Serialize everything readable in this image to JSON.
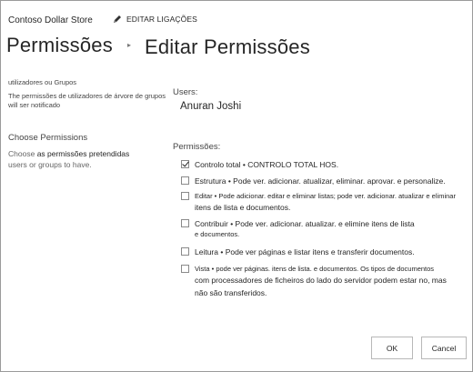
{
  "header": {
    "site_name": "Contoso Dollar Store",
    "edit_links": "EDITAR LIGAÇÕES",
    "breadcrumb_root": "Permissões",
    "breadcrumb_current": "Editar Permissões"
  },
  "left": {
    "users_groups_title": "utilizadores ou Grupos",
    "users_groups_desc_line1": "The permissões de utilizadores de árvore de grupos",
    "users_groups_desc_line2": "will ser notificado",
    "choose_heading": "Choose Permissions",
    "choose_desc_prefix": "Choose",
    "choose_desc_strong": "as permissões pretendidas",
    "choose_desc_line2": "users or groups to have."
  },
  "users": {
    "label": "Users:",
    "name": "Anuran Joshi"
  },
  "permissions": {
    "label": "Permissões:",
    "items": [
      {
        "checked": true,
        "line1": "Controlo total • CONTROLO TOTAL HOS.",
        "line2": ""
      },
      {
        "checked": false,
        "line1": "Estrutura • Pode ver. adicionar. atualizar, eliminar. aprovar. e personalize.",
        "line2": ""
      },
      {
        "checked": false,
        "line1": "Editar • Pode adicionar. editar e eliminar listas; pode ver. adicionar. atualizar e eliminar",
        "line2": "itens de lista e documentos."
      },
      {
        "checked": false,
        "line1": "Contribuir • Pode ver. adicionar. atualizar. e elimine itens de lista",
        "line2": "e documentos."
      },
      {
        "checked": false,
        "line1": "Leitura • Pode ver páginas e listar itens e transferir documentos.",
        "line2": ""
      },
      {
        "checked": false,
        "line1": "Vista • pode ver páginas. itens de lista. e documentos. Os tipos de documentos",
        "line2": "com processadores de ficheiros do lado do servidor podem estar no, mas",
        "line3": "não são transferidos."
      }
    ]
  },
  "buttons": {
    "ok": "OK",
    "cancel": "Cancel"
  }
}
